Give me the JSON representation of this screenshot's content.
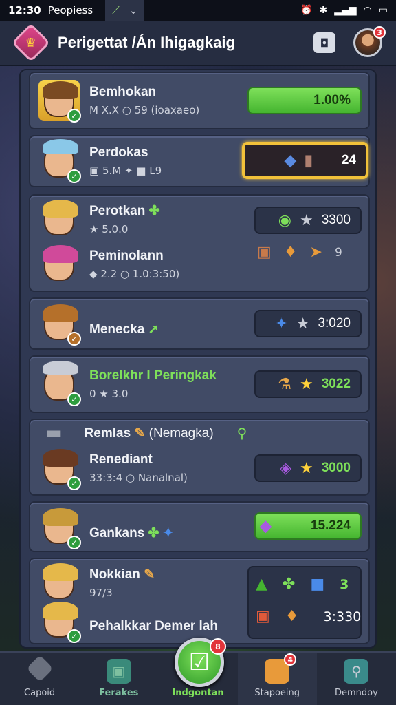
{
  "status": {
    "time": "12:30",
    "app": "Peopiess",
    "signal_icon": "pen-icon",
    "down_icon": "chevron-down-icon"
  },
  "header": {
    "title": "Perigettat /Án Ihigagkaig",
    "avatar_badge": "3"
  },
  "rows": [
    {
      "name": "Bemhokan",
      "sub": "M  X.X  ○  59  (ioaxaeo)",
      "value": "1.00%",
      "style": "green"
    },
    {
      "name": "Perdokas",
      "sub": "▣ 5.M  ✦  ■  L9",
      "value": "24",
      "style": "gold"
    },
    {
      "name": "Perotkan",
      "sub": "★ 5.0.0",
      "value": "3300",
      "style": "dark"
    },
    {
      "name": "Peminolann",
      "sub": "◆ 2.2  ○ 1.0:3:50)",
      "value": "9",
      "style": "plain"
    },
    {
      "name": "Menecka",
      "sub": "",
      "value": "3:020",
      "style": "dark"
    },
    {
      "name": "Borelkhr I Peringkak",
      "sub": "0  ★ 3.0",
      "value": "3022",
      "style": "dark-green"
    },
    {
      "name": "Remlas",
      "sub": "(Nemagka)",
      "value": "",
      "style": "none"
    },
    {
      "name": "Renediant",
      "sub": "33:3:4  ○  Nanalnal)",
      "value": "3000",
      "style": "dark-green"
    },
    {
      "name": "Gankans",
      "sub": "",
      "value": "15.224",
      "style": "green"
    },
    {
      "name": "Nokkian",
      "sub": "97/3",
      "value": "3",
      "style": "dark-green"
    },
    {
      "name": "Pehalkkar Demer lah",
      "sub": "",
      "value": "3:330",
      "style": "dark"
    }
  ],
  "nav": [
    {
      "label": "Capoid",
      "icon": "shield-icon"
    },
    {
      "label": "Ferakes",
      "icon": "bag-icon"
    },
    {
      "label": "Indgontan",
      "icon": "check-icon",
      "badge": "8"
    },
    {
      "label": "Stapoeing",
      "icon": "chest-icon",
      "badge": "4"
    },
    {
      "label": "Demndoy",
      "icon": "map-icon"
    }
  ]
}
